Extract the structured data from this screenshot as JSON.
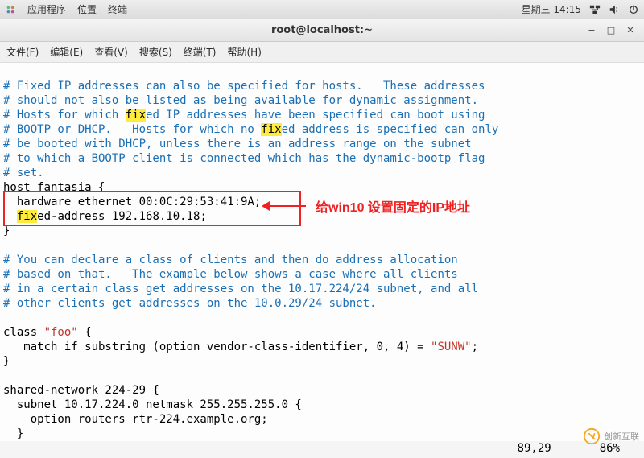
{
  "topbar": {
    "apps": "应用程序",
    "places": "位置",
    "terminal": "终端",
    "clock": "星期三 14:15"
  },
  "window": {
    "title": "root@localhost:~"
  },
  "menubar": {
    "file": "文件(F)",
    "edit": "编辑(E)",
    "view": "查看(V)",
    "search": "搜索(S)",
    "terminal": "终端(T)",
    "help": "帮助(H)"
  },
  "terminal": {
    "c1": "# Fixed IP addresses can also be specified for hosts.   These addresses",
    "c2": "# should not also be listed as being available for dynamic assignment.",
    "c3a": "# Hosts for which ",
    "c3_fix": "fix",
    "c3b": "ed IP addresses have been specified can boot using",
    "c4a": "# BOOTP or DHCP.   Hosts for which no ",
    "c4_fix": "fix",
    "c4b": "ed address is specified can only",
    "c5": "# be booted with DHCP, unless there is an address range on the subnet",
    "c6": "# to which a BOOTP client is connected which has the dynamic-bootp flag",
    "c7": "# set.",
    "host_line": "host fantasia {",
    "hw_line": "  hardware ethernet 00:0C:29:53:41:9A;",
    "fixaddr_pre": "  ",
    "fixaddr_fix": "fix",
    "fixaddr_post": "ed-address 192.168.10.18;",
    "close1": "}",
    "blank": "",
    "c8": "# You can declare a class of clients and then do address allocation",
    "c9": "# based on that.   The example below shows a case where all clients",
    "c10": "# in a certain class get addresses on the 10.17.224/24 subnet, and all",
    "c11": "# other clients get addresses on the 10.0.29/24 subnet.",
    "class_pre": "class ",
    "class_foo": "\"foo\"",
    "class_post": " {",
    "match_pre": "   match if substring (option vendor-class-identifier, 0, 4) = ",
    "match_sunw": "\"SUNW\"",
    "match_post": ";",
    "close2": "}",
    "shared": "shared-network 224-29 {",
    "subnet": "  subnet 10.17.224.0 netmask 255.255.255.0 {",
    "routers": "    option routers rtr-224.example.org;",
    "close3": "  }"
  },
  "annotation": {
    "text": "给win10 设置固定的IP地址"
  },
  "status": {
    "pos": "89,29",
    "pct": "86%"
  },
  "watermark": {
    "text": "创新互联"
  }
}
